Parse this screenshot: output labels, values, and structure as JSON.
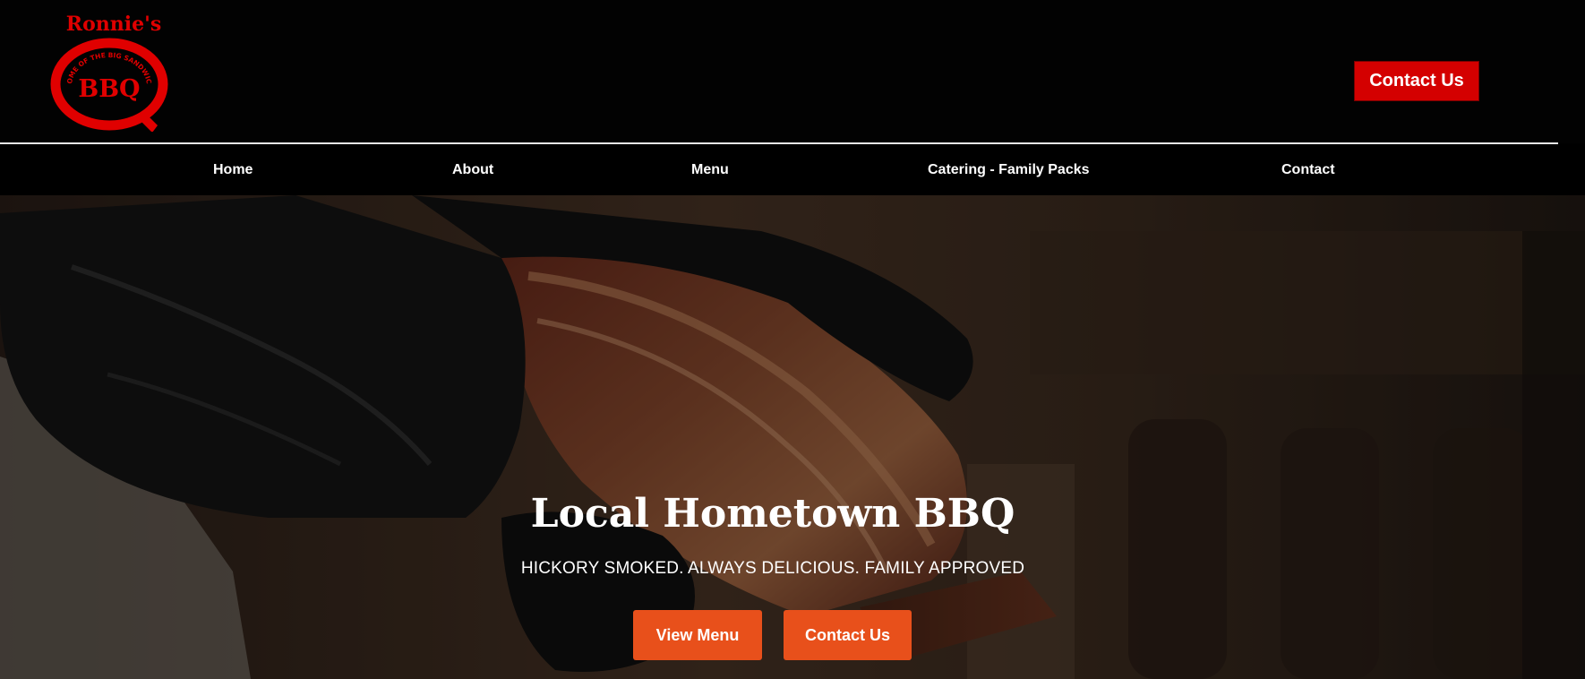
{
  "brand": {
    "logo_top_text": "Ronnie's",
    "logo_ring_text": "HOME OF THE BIG SANDWICH",
    "logo_main_text": "BBQ",
    "color_primary": "#e00000"
  },
  "header": {
    "cta_label": "Contact Us"
  },
  "nav": {
    "items": [
      {
        "label": "Home"
      },
      {
        "label": "About"
      },
      {
        "label": "Menu"
      },
      {
        "label": "Catering - Family Packs"
      },
      {
        "label": "Contact"
      }
    ]
  },
  "hero": {
    "title": "Local Hometown BBQ",
    "subtitle": "HICKORY SMOKED. ALWAYS DELICIOUS. FAMILY APPROVED",
    "buttons": [
      {
        "label": "View Menu"
      },
      {
        "label": "Contact Us"
      }
    ],
    "button_color": "#e8501b"
  }
}
